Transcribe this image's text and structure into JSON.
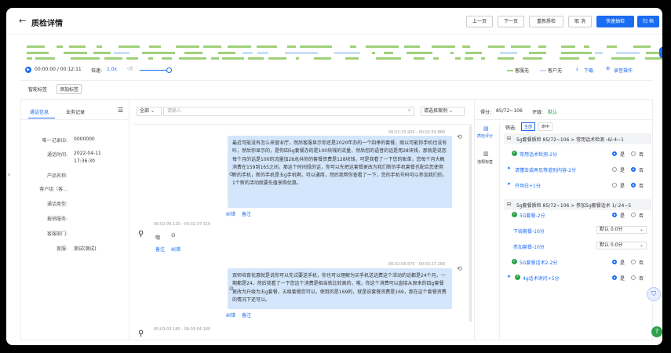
{
  "header": {
    "title": "质检详情",
    "buttons": {
      "prev": "上一页",
      "next": "下一页",
      "recheck": "重新质检",
      "cancel": "取 消",
      "quick_sample": "快速抽检",
      "archive": "归 档"
    }
  },
  "player": {
    "time": "00:00:00 / 00:12:11",
    "speed_label": "倍速:",
    "speed": "1.0x",
    "legend_agent": "客服无",
    "legend_customer": "客户无",
    "download": "下载",
    "recording_ops": "录音操作"
  },
  "tags": {
    "label": "智能标签",
    "add": "添加标签"
  },
  "left_tabs": {
    "call_info": "通话信息",
    "business": "业务记录"
  },
  "info": [
    {
      "key": "唯一记录ID:",
      "value": "0000000"
    },
    {
      "key": "通话时间:",
      "value": "2022-04-11"
    },
    {
      "key": "",
      "value": "17:36:30"
    },
    {
      "key": "产品名称:",
      "value": ""
    },
    {
      "key": "客户组（客...",
      "value": ""
    },
    {
      "key": "通话类型:",
      "value": ""
    },
    {
      "key": "报销服务:",
      "value": ""
    },
    {
      "key": "客服部门:",
      "value": ""
    },
    {
      "key": "客服:",
      "value": "测试(测试)"
    }
  ],
  "search": {
    "scope": "全部",
    "placeholder": "请输入",
    "case_select": "请选择案例"
  },
  "messages": [
    {
      "time": "00:02:15.920 - 00:02:59.880",
      "text": "最近可能没有怎么来营业厅，然后客服显示你还是2020年办的一个四季的套餐，刚以可能你手机也没有咔，然后你显示的，是你四5g套餐办的是100块钱的流量，然后您的语音的话是用28块钱，那就是说您每个月的话是100的流量加28总共你的套餐资费是128块钱，可是我看了一下您的账单，您每个月大概消费在159到165之间，那这个时间段的话，你可以先把这套餐更改为我们新的手机套餐也配合您使用新的手机，新的手机是五g手机啊，可以通用，然后我帮你查看了一下，您的手机号码可以参加我们的，1个新的活动就要先值享购优惠。",
      "actions": [
        "纠错",
        "备注"
      ]
    },
    {
      "time": "00:02:06.120 - 00:02:37.310",
      "text": "哦",
      "actions": [
        "备注",
        "纠错"
      ]
    },
    {
      "time": "00:02:59.870 - 00:03:27.280",
      "text": "双师培育优惠就是说你可以先试要送手机，你也可以理解为买手机送话费这个活动的话都是24个月，一期都是24，然后我看了一下您这个消费是相当就比较高的，哦，你这个消费可以直接从原来的四g套餐更改为升级为五g套餐，五级套餐您可以，使用的是169的，就是说套餐资费是169，那在这个套餐资费的情况下还可以。",
      "actions": [
        "纠错",
        "备注"
      ]
    },
    {
      "time": "00:03:03.180 - 00:03:04.180",
      "text": "",
      "actions": []
    }
  ],
  "score": {
    "label": "得分:",
    "value": "85/72~106",
    "grade_label": "评级:",
    "grade": "默认",
    "side_tabs": [
      "质检评分",
      "违规标签"
    ],
    "filter_label": "筛选:",
    "filters": [
      "全部",
      "命中"
    ],
    "groups": [
      {
        "title": "5g套餐质检 85/72~106 > 常用话术检测 -6/-4~1"
      },
      {
        "title": "5g套餐质检 85/72~106 > 参加5g套餐话术 1/-24~5"
      }
    ],
    "items": [
      {
        "label": "常用话术检测-2分",
        "yes": "是",
        "no": "否",
        "selected": "yes"
      },
      {
        "label": "请懂去或再见等道别内容-2分",
        "yes": "是",
        "no": "否",
        "selected": "no"
      },
      {
        "label": "开场白+1分",
        "yes": "是",
        "no": "否",
        "selected": "no"
      },
      {
        "label": "5G套餐-2分",
        "yes": "是",
        "no": "否",
        "selected": "yes"
      },
      {
        "label": "下线套餐-10分",
        "select": "默认 0.0分"
      },
      {
        "label": "参加套餐-10分",
        "select": "默认 0.0分"
      },
      {
        "label": "5G套餐话术2-2分",
        "yes": "是",
        "no": "否",
        "selected": "yes"
      },
      {
        "label": "4g话术询问+5分",
        "yes": "是",
        "no": "否",
        "selected": "yes"
      }
    ]
  }
}
